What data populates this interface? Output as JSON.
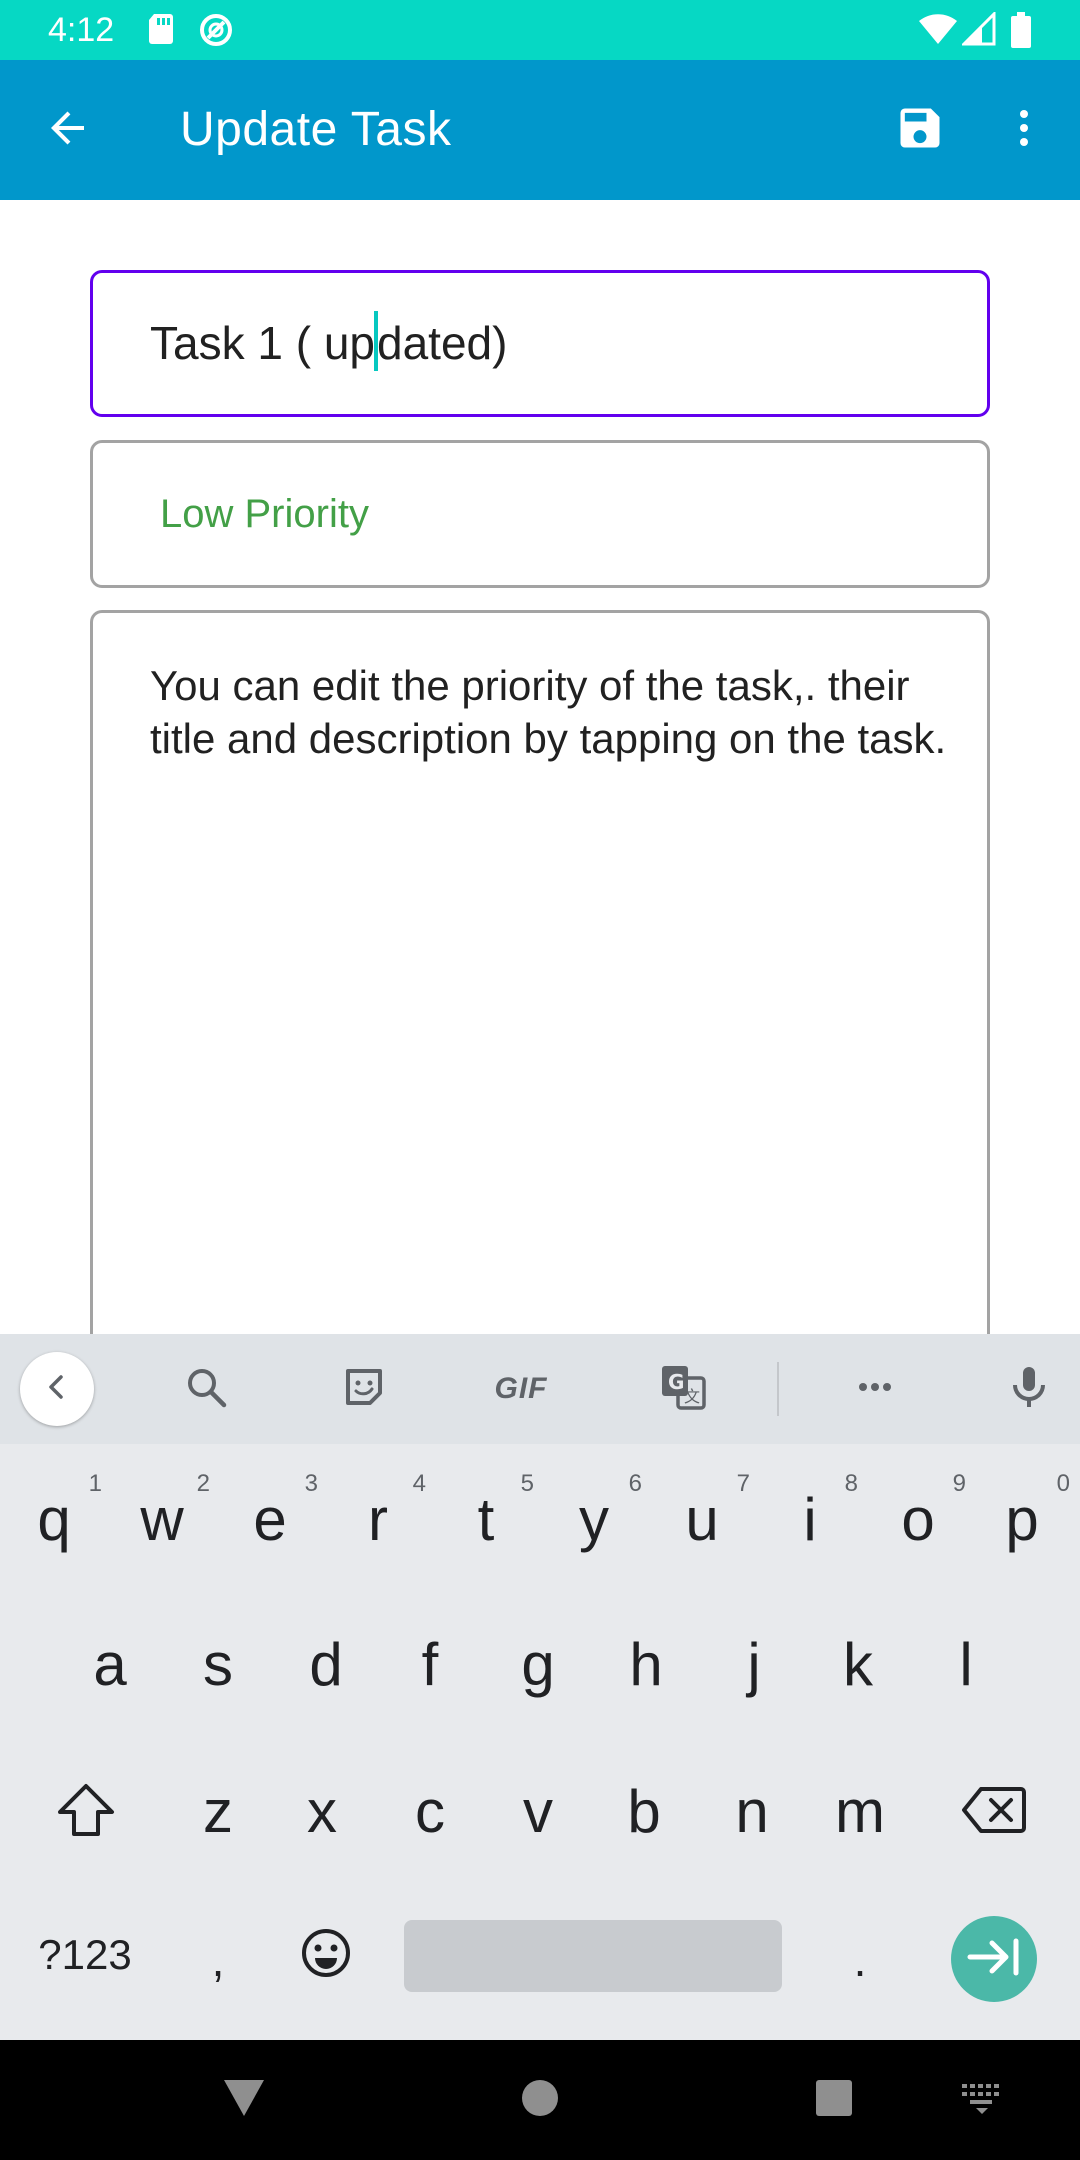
{
  "status_bar": {
    "time": "4:12",
    "background": "#06d8c4",
    "left_icons": [
      "sd-card-icon",
      "do-not-disturb-icon"
    ],
    "right_icons": [
      "wifi-icon",
      "signal-icon",
      "battery-icon"
    ]
  },
  "app_bar": {
    "title": "Update Task",
    "background": "#0197cb",
    "back_icon": "arrow-back-icon",
    "save_icon": "save-icon",
    "menu_icon": "more-vert-icon"
  },
  "form": {
    "title_value_before_caret": "Task 1 ( up",
    "title_value_after_caret": "dated)",
    "priority_value": "Low Priority",
    "priority_color": "#43a047",
    "description_value": "You can edit the priority of the task,. their title and description by tapping on the task.",
    "focused_border_color": "#6200ee"
  },
  "keyboard": {
    "toolbar_icons": [
      "chevron-left-icon",
      "search-icon",
      "sticker-icon",
      "gif-icon",
      "translate-icon",
      "more-horiz-icon",
      "mic-icon"
    ],
    "gif_label": "GIF",
    "row1": [
      {
        "ch": "q",
        "hint": "1"
      },
      {
        "ch": "w",
        "hint": "2"
      },
      {
        "ch": "e",
        "hint": "3"
      },
      {
        "ch": "r",
        "hint": "4"
      },
      {
        "ch": "t",
        "hint": "5"
      },
      {
        "ch": "y",
        "hint": "6"
      },
      {
        "ch": "u",
        "hint": "7"
      },
      {
        "ch": "i",
        "hint": "8"
      },
      {
        "ch": "o",
        "hint": "9"
      },
      {
        "ch": "p",
        "hint": "0"
      }
    ],
    "row2": [
      "a",
      "s",
      "d",
      "f",
      "g",
      "h",
      "j",
      "k",
      "l"
    ],
    "row3": [
      "z",
      "x",
      "c",
      "v",
      "b",
      "n",
      "m"
    ],
    "symbols_label": "?123",
    "comma": ",",
    "period": ".",
    "enter_color": "#4bb8a8"
  },
  "nav_bar": {
    "icons": [
      "back-triangle-icon",
      "home-circle-icon",
      "recents-square-icon",
      "keyboard-switch-icon"
    ]
  }
}
